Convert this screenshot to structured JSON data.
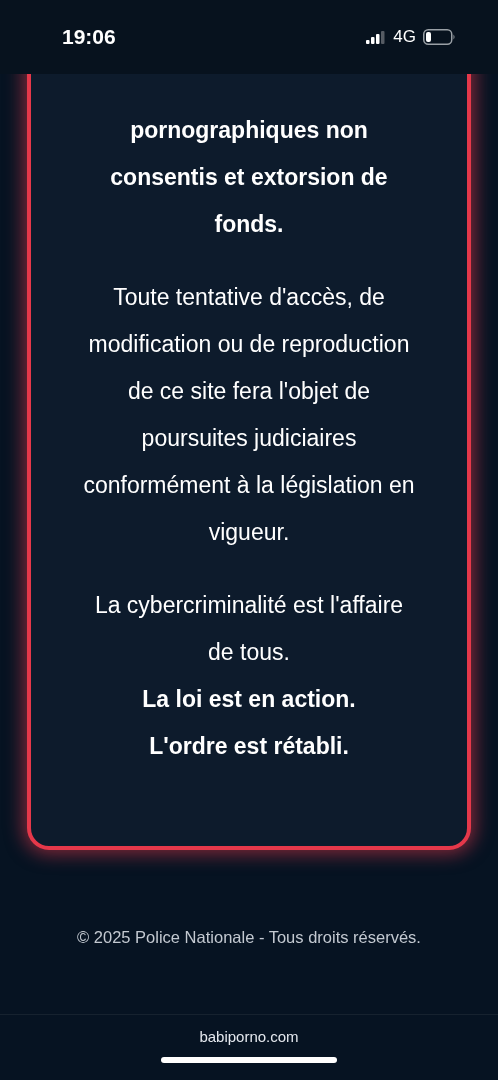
{
  "status_bar": {
    "time": "19:06",
    "network": "4G"
  },
  "notice": {
    "paragraphs": [
      {
        "sentences": [
          {
            "text": "pornographiques non consentis et extorsion de fonds.",
            "bold": true
          }
        ]
      },
      {
        "sentences": [
          {
            "text": "Toute tentative d'accès, de modification ou de reproduction de ce site fera l'objet de poursuites judiciaires conformément à la législation en vigueur.",
            "bold": false
          }
        ]
      },
      {
        "sentences": [
          {
            "text": "La cybercriminalité est l'affaire de tous.",
            "bold": false
          },
          {
            "text": "La loi est en action.",
            "bold": true
          },
          {
            "text": "L'ordre est rétabli.",
            "bold": true
          }
        ]
      }
    ]
  },
  "footer": {
    "copyright": "© 2025 Police Nationale - Tous droits réservés."
  },
  "browser_bar": {
    "url": "babiporno.com"
  }
}
